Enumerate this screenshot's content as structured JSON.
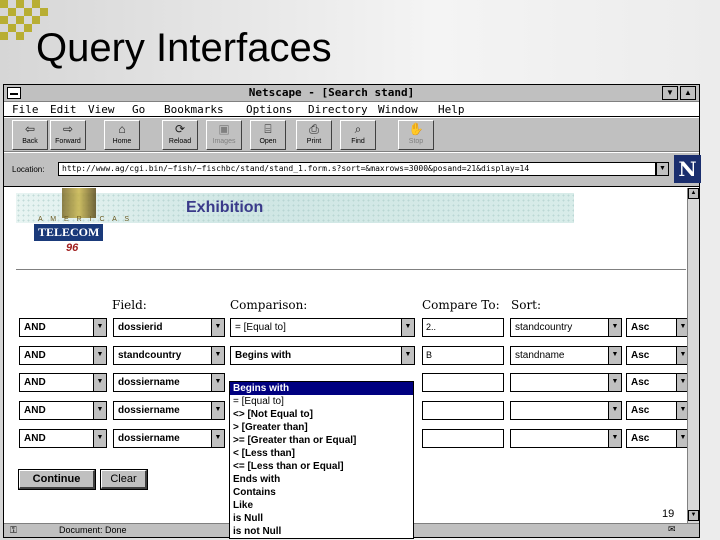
{
  "slide": {
    "title": "Query Interfaces",
    "page_number": "19"
  },
  "window": {
    "title": "Netscape - [Search stand]",
    "menu": [
      "File",
      "Edit",
      "View",
      "Go",
      "Bookmarks",
      "Options",
      "Directory",
      "Window",
      "Help"
    ],
    "toolbar": [
      {
        "label": "Back",
        "icon": "back-arrow-icon"
      },
      {
        "label": "Forward",
        "icon": "forward-arrow-icon"
      },
      {
        "label": "Home",
        "icon": "home-icon"
      },
      {
        "label": "Reload",
        "icon": "reload-icon"
      },
      {
        "label": "Images",
        "icon": "images-icon"
      },
      {
        "label": "Open",
        "icon": "open-icon"
      },
      {
        "label": "Print",
        "icon": "print-icon"
      },
      {
        "label": "Find",
        "icon": "find-icon"
      },
      {
        "label": "Stop",
        "icon": "stop-icon"
      }
    ],
    "location_label": "Location:",
    "location_url": "http://www.ag/cgi.bin/~fish/~fischbc/stand/stand_1.form.s?sort=&maxrows=3000&posand=21&display=14",
    "status_text": "Document: Done"
  },
  "page": {
    "banner_title": "Exhibition",
    "logo_top": "A M E R I C A S",
    "logo_name": "TELECOM",
    "logo_year": "96",
    "headers": {
      "field": "Field:",
      "comparison": "Comparison:",
      "compare_to": "Compare To:",
      "sort": "Sort:"
    },
    "rows": [
      {
        "op": "AND",
        "field": "dossierid",
        "comparison": "= [Equal to]",
        "compare": "2..",
        "sort_field": "standcountry",
        "order": "Asc"
      },
      {
        "op": "AND",
        "field": "standcountry",
        "comparison": "Begins with",
        "compare": "B",
        "sort_field": "standname",
        "order": "Asc"
      },
      {
        "op": "AND",
        "field": "dossiername",
        "comparison": "",
        "compare": "",
        "sort_field": "",
        "order": "Asc"
      },
      {
        "op": "AND",
        "field": "dossiername",
        "comparison": "",
        "compare": "",
        "sort_field": "",
        "order": "Asc"
      },
      {
        "op": "AND",
        "field": "dossiername",
        "comparison": "",
        "compare": "",
        "sort_field": "",
        "order": "Asc"
      }
    ],
    "comparison_options": [
      "Begins with",
      "= [Equal to]",
      "<> [Not Equal to]",
      "> [Greater than]",
      ">= [Greater than or Equal]",
      "< [Less than]",
      "<= [Less than or Equal]",
      "Ends with",
      "Contains",
      "Like",
      "is Null",
      "is not Null"
    ],
    "continue_label": "Continue",
    "clear_label": "Clear"
  }
}
